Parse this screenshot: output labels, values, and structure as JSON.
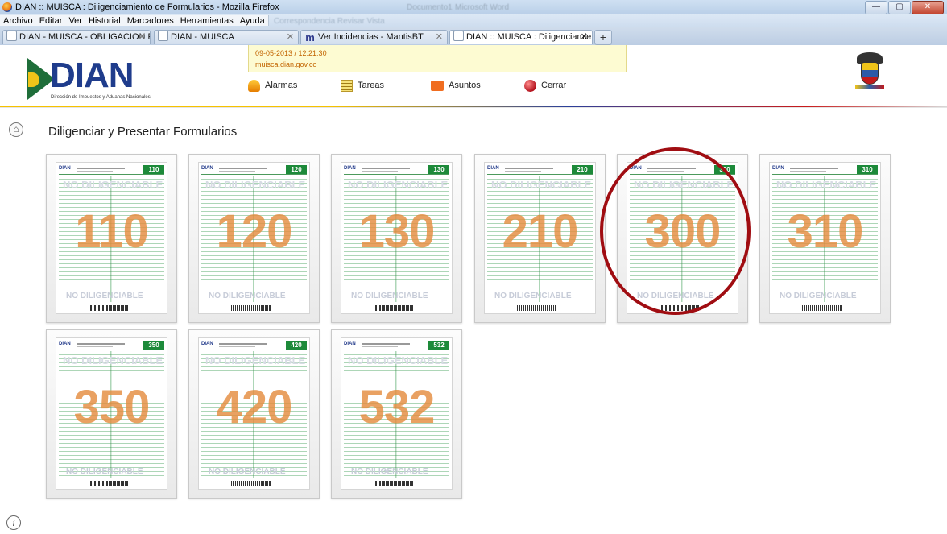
{
  "window": {
    "title": "DIAN :: MUISCA : Diligenciamiento de Formularios - Mozilla Firefox",
    "background_title_1": "Documento1",
    "background_title_2": "Microsoft Word",
    "controls": {
      "minimize": "—",
      "maximize": "▢",
      "close": "✕"
    }
  },
  "menu": {
    "items": [
      "Archivo",
      "Editar",
      "Ver",
      "Historial",
      "Marcadores",
      "Herramientas",
      "Ayuda"
    ],
    "background_menu": "Correspondencia   Revisar   Vista"
  },
  "tabs": [
    {
      "label": "DIAN - MUISCA - OBLIGACION FINA...",
      "icon": "page-icon",
      "active": false
    },
    {
      "label": "DIAN - MUISCA",
      "icon": "page-icon",
      "active": false
    },
    {
      "label": "Ver Incidencias - MantisBT",
      "icon": "mantis-icon",
      "active": false
    },
    {
      "label": "DIAN :: MUISCA : Diligenciamiento d...",
      "icon": "page-icon",
      "active": true
    }
  ],
  "new_tab": "+",
  "header": {
    "logo_word": "DIAN",
    "logo_subtitle": "Dirección de Impuestos y Aduanas Nacionales",
    "info_date": "09-05-2013 / 12:21:30",
    "info_host": "muisca.dian.gov.co",
    "nav": [
      {
        "label": "Alarmas",
        "icon": "alarm-icon"
      },
      {
        "label": "Tareas",
        "icon": "tasks-icon"
      },
      {
        "label": "Asuntos",
        "icon": "folder-icon"
      },
      {
        "label": "Cerrar",
        "icon": "exit-icon"
      }
    ]
  },
  "main": {
    "title": "Diligenciar y Presentar Formularios",
    "watermark_top": "NO DILIGENCIABLE",
    "watermark_bottom": "NO DILIGENCIABLE",
    "forms": [
      {
        "number": "110",
        "highlighted": false
      },
      {
        "number": "120",
        "highlighted": false
      },
      {
        "number": "130",
        "highlighted": false
      },
      {
        "number": "210",
        "highlighted": false
      },
      {
        "number": "300",
        "highlighted": true
      },
      {
        "number": "310",
        "highlighted": false
      },
      {
        "number": "350",
        "highlighted": false
      },
      {
        "number": "420",
        "highlighted": false
      },
      {
        "number": "532",
        "highlighted": false
      }
    ]
  },
  "colors": {
    "brand_green": "#1d8a3a",
    "brand_blue": "#1f3c8c",
    "watermark_orange": "#e48c40",
    "highlight_red": "#a00d12"
  }
}
